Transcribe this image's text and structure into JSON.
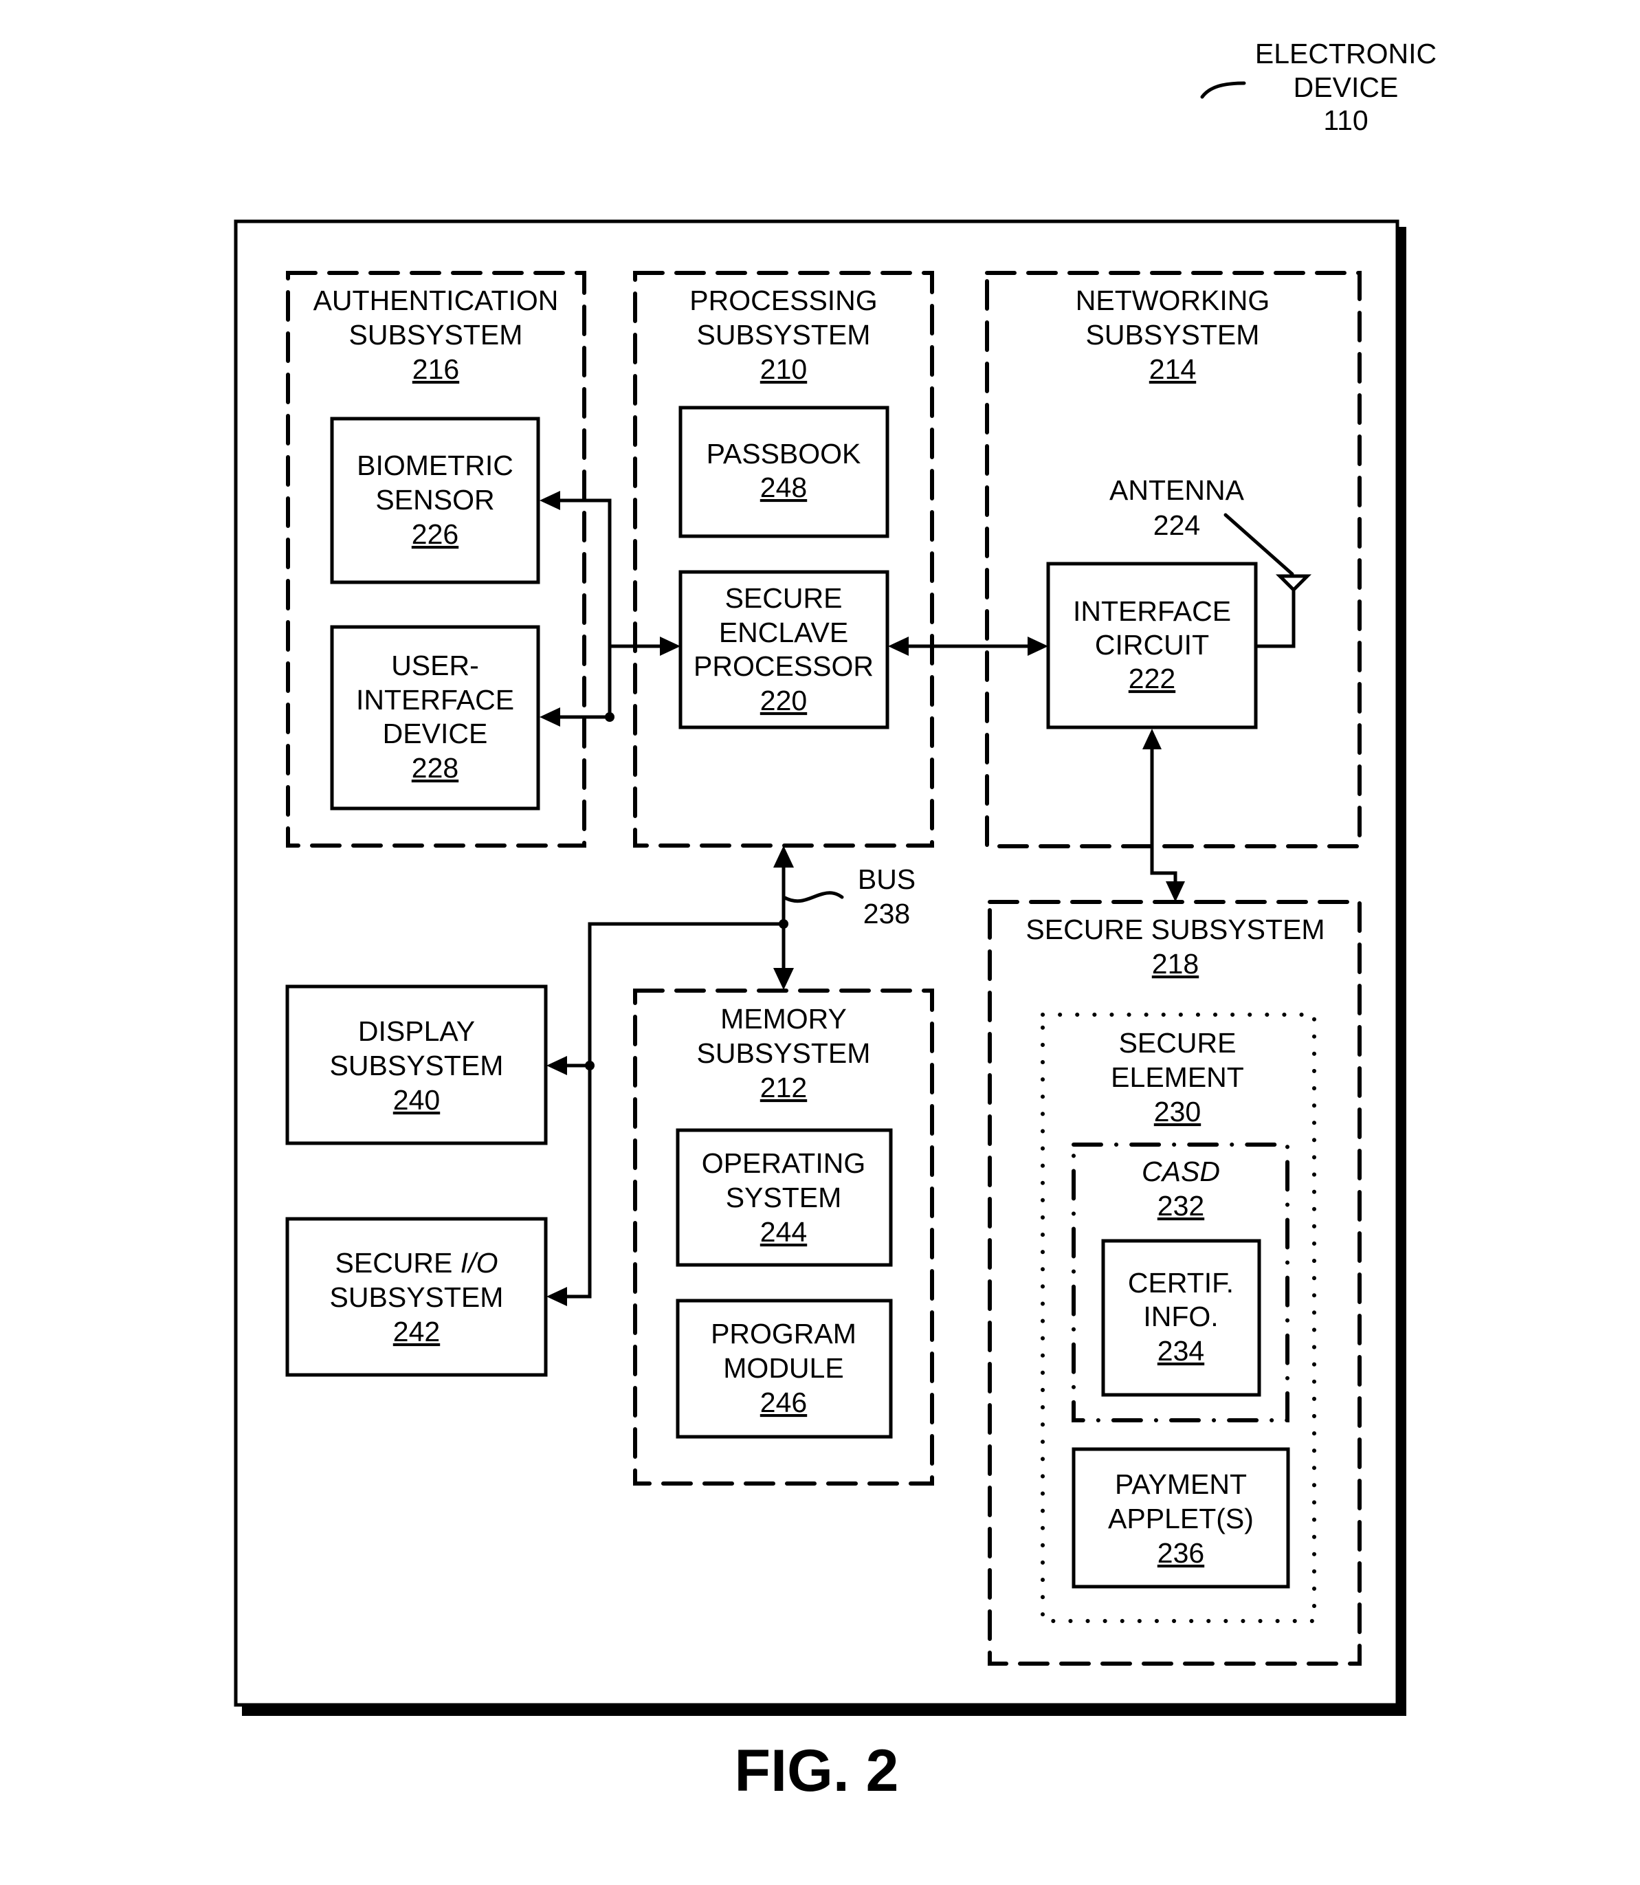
{
  "figure": {
    "caption": "FIG. 2",
    "device_label": [
      "ELECTRONIC",
      "DEVICE",
      "110"
    ]
  },
  "blocks": {
    "authentication": {
      "lines": [
        "AUTHENTICATION",
        "SUBSYSTEM"
      ],
      "ref": "216"
    },
    "processing": {
      "lines": [
        "PROCESSING",
        "SUBSYSTEM"
      ],
      "ref": "210"
    },
    "networking": {
      "lines": [
        "NETWORKING",
        "SUBSYSTEM"
      ],
      "ref": "214"
    },
    "biometric": {
      "lines": [
        "BIOMETRIC",
        "SENSOR"
      ],
      "ref": "226"
    },
    "ui_device": {
      "lines": [
        "USER-",
        "INTERFACE",
        "DEVICE"
      ],
      "ref": "228"
    },
    "passbook": {
      "lines": [
        "PASSBOOK"
      ],
      "ref": "248"
    },
    "sep": {
      "lines": [
        "SECURE",
        "ENCLAVE",
        "PROCESSOR"
      ],
      "ref": "220"
    },
    "interface": {
      "lines": [
        "INTERFACE",
        "CIRCUIT"
      ],
      "ref": "222"
    },
    "antenna": {
      "lines": [
        "ANTENNA",
        "224"
      ]
    },
    "bus": {
      "lines": [
        "BUS",
        "238"
      ]
    },
    "display": {
      "lines": [
        "DISPLAY",
        "SUBSYSTEM"
      ],
      "ref": "240"
    },
    "secure_io": {
      "lines": [
        "SECURE I/O",
        "SUBSYSTEM"
      ],
      "line1_prefix": "SECURE ",
      "line1_italic": "I/O",
      "ref": "242"
    },
    "memory": {
      "lines": [
        "MEMORY",
        "SUBSYSTEM"
      ],
      "ref": "212"
    },
    "os": {
      "lines": [
        "OPERATING",
        "SYSTEM"
      ],
      "ref": "244"
    },
    "program": {
      "lines": [
        "PROGRAM",
        "MODULE"
      ],
      "ref": "246"
    },
    "secure_subsystem": {
      "lines": [
        "SECURE SUBSYSTEM"
      ],
      "ref": "218"
    },
    "secure_element": {
      "lines": [
        "SECURE",
        "ELEMENT"
      ],
      "ref": "230"
    },
    "casd": {
      "lines": [
        "CASD"
      ],
      "ref": "232"
    },
    "certif": {
      "lines": [
        "CERTIF.",
        "INFO."
      ],
      "ref": "234"
    },
    "payment": {
      "lines": [
        "PAYMENT",
        "APPLET(S)"
      ],
      "ref": "236"
    }
  }
}
